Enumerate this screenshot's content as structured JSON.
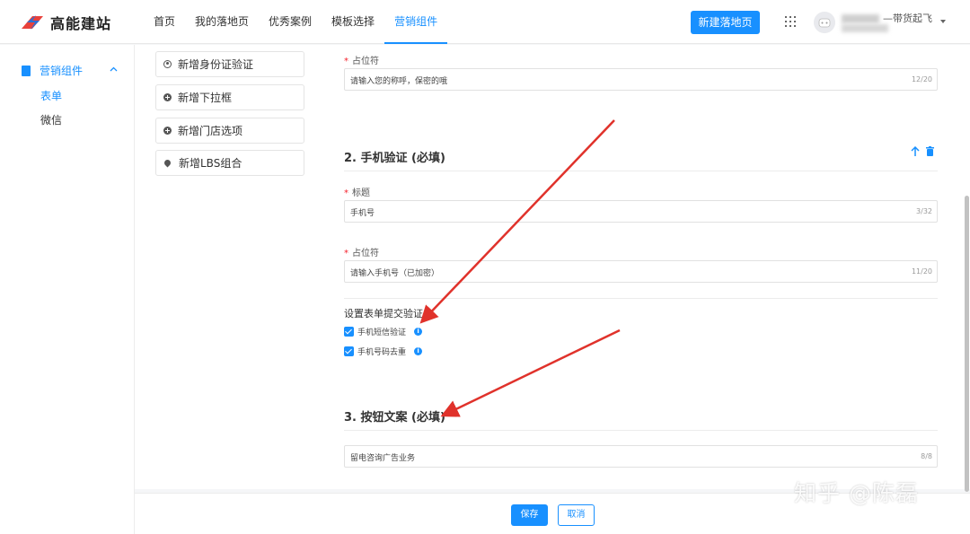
{
  "header": {
    "logo_text": "高能建站",
    "nav": [
      {
        "label": "首页",
        "active": false
      },
      {
        "label": "我的落地页",
        "active": false
      },
      {
        "label": "优秀案例",
        "active": false
      },
      {
        "label": "模板选择",
        "active": false
      },
      {
        "label": "营销组件",
        "active": true
      }
    ],
    "new_page_button": "新建落地页",
    "user_name_suffix": "—带货起飞"
  },
  "sidebar": {
    "group_label": "营销组件",
    "items": [
      {
        "label": "表单",
        "active": true
      },
      {
        "label": "微信",
        "active": false
      }
    ]
  },
  "components": {
    "items": [
      {
        "label": "新增身份证验证",
        "icon": "person-icon"
      },
      {
        "label": "新增下拉框",
        "icon": "plus-circle-icon"
      },
      {
        "label": "新增门店选项",
        "icon": "plus-circle-icon"
      },
      {
        "label": "新增LBS组合",
        "icon": "location-pin-icon"
      }
    ]
  },
  "form": {
    "field1": {
      "label": "占位符",
      "value": "请输入您的称呼，保密的哦",
      "count": "12/20"
    },
    "section2": {
      "title": "2. 手机验证 (必填)",
      "title_field": {
        "label": "标题",
        "value": "手机号",
        "count": "3/32"
      },
      "placeholder_field": {
        "label": "占位符",
        "value": "请输入手机号（已加密）",
        "count": "11/20"
      },
      "validation_title": "设置表单提交验证",
      "checks": [
        {
          "label": "手机短信验证",
          "checked": true
        },
        {
          "label": "手机号码去重",
          "checked": true
        }
      ]
    },
    "section3": {
      "title": "3. 按钮文案 (必填)",
      "field": {
        "value": "留电咨询广告业务",
        "count": "8/8"
      }
    }
  },
  "footer": {
    "save": "保存",
    "cancel": "取消"
  },
  "watermark": "知乎 @陈磊",
  "colors": {
    "accent": "#1890ff",
    "arrow": "#e0322b",
    "required": "#f5222d"
  }
}
